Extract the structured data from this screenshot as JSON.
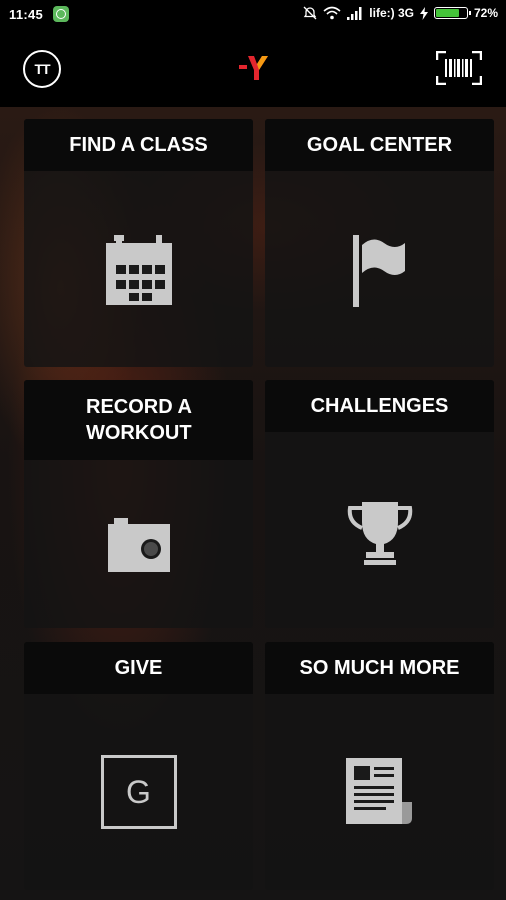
{
  "status_bar": {
    "time": "11:45",
    "carrier": "life:) 3G",
    "battery": "72%",
    "battery_level": 0.72
  },
  "header": {
    "avatar_initials": "TT",
    "logo_icon": "ymca-logo-icon",
    "scan_icon": "barcode-scan-icon"
  },
  "tiles": [
    {
      "label": "FIND A CLASS",
      "icon": "calendar-icon"
    },
    {
      "label": "GOAL CENTER",
      "icon": "flag-icon"
    },
    {
      "label": "RECORD A WORKOUT",
      "icon": "camera-icon"
    },
    {
      "label": "CHALLENGES",
      "icon": "trophy-icon"
    },
    {
      "label": "GIVE",
      "icon": "give-g-icon",
      "icon_text": "G"
    },
    {
      "label": "SO MUCH MORE",
      "icon": "newspaper-icon"
    }
  ],
  "colors": {
    "accent_red": "#e3262e",
    "accent_orange": "#f59a12",
    "battery_green": "#45c43a",
    "icon_gray": "#c9c9c9"
  }
}
